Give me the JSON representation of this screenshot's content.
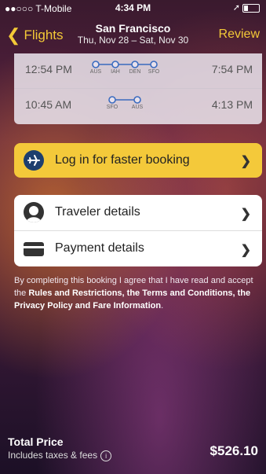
{
  "status_bar": {
    "carrier": "●●○○○ T-Mobile",
    "time": "4:34 PM"
  },
  "nav": {
    "back_label": "Flights",
    "title_city": "San Francisco",
    "title_dates": "Thu, Nov 28 – Sat, Nov 30",
    "review_label": "Review"
  },
  "flights": [
    {
      "depart": "12:54 PM",
      "arrive": "7:54 PM",
      "stops": [
        "AUS",
        "IAH",
        "DEN",
        "SFO"
      ]
    },
    {
      "depart": "10:45 AM",
      "arrive": "4:13 PM",
      "stops": [
        "SFO",
        "AUS"
      ]
    }
  ],
  "login": {
    "label": "Log in for faster booking"
  },
  "details": {
    "traveler_label": "Traveler details",
    "payment_label": "Payment details"
  },
  "terms": {
    "prefix": "By completing this booking I agree that I have read and accept the ",
    "bold": "Rules and Restrictions, the Terms and Conditions, the Privacy Policy and Fare Information",
    "suffix": "."
  },
  "total": {
    "title": "Total Price",
    "subtitle": "Includes taxes & fees",
    "price": "$526.10"
  },
  "colors": {
    "accent": "#f3c937",
    "button_yellow": "#f4c93a",
    "icon_navy": "#1e3f6e"
  }
}
